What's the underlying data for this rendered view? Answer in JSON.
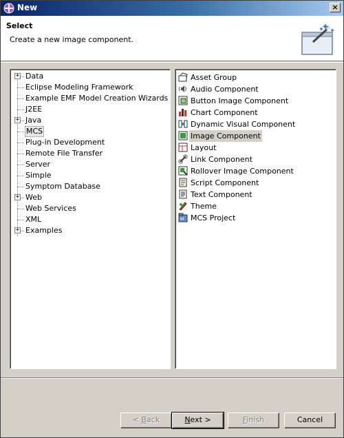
{
  "window": {
    "title": "New",
    "close_symbol": "×"
  },
  "header": {
    "title": "Select",
    "description": "Create a new image component."
  },
  "tree": {
    "items": [
      {
        "label": "Data",
        "expandable": true
      },
      {
        "label": "Eclipse Modeling Framework",
        "expandable": false
      },
      {
        "label": "Example EMF Model Creation Wizards",
        "expandable": false
      },
      {
        "label": "J2EE",
        "expandable": false
      },
      {
        "label": "Java",
        "expandable": true
      },
      {
        "label": "MCS",
        "expandable": false,
        "selected": true
      },
      {
        "label": "Plug-in Development",
        "expandable": false
      },
      {
        "label": "Remote File Transfer",
        "expandable": false
      },
      {
        "label": "Server",
        "expandable": false
      },
      {
        "label": "Simple",
        "expandable": false
      },
      {
        "label": "Symptom Database",
        "expandable": false
      },
      {
        "label": "Web",
        "expandable": true
      },
      {
        "label": "Web Services",
        "expandable": false
      },
      {
        "label": "XML",
        "expandable": false
      },
      {
        "label": "Examples",
        "expandable": true
      }
    ],
    "expander_symbol": "+"
  },
  "wizards": {
    "items": [
      {
        "label": "Asset Group",
        "icon": "asset-group-icon"
      },
      {
        "label": "Audio Component",
        "icon": "audio-icon"
      },
      {
        "label": "Button Image Component",
        "icon": "button-image-icon"
      },
      {
        "label": "Chart Component",
        "icon": "chart-icon"
      },
      {
        "label": "Dynamic Visual Component",
        "icon": "dynamic-visual-icon"
      },
      {
        "label": "Image Component",
        "icon": "image-icon",
        "selected": true
      },
      {
        "label": "Layout",
        "icon": "layout-icon"
      },
      {
        "label": "Link Component",
        "icon": "link-icon"
      },
      {
        "label": "Rollover Image Component",
        "icon": "rollover-image-icon"
      },
      {
        "label": "Script Component",
        "icon": "script-icon"
      },
      {
        "label": "Text Component",
        "icon": "text-icon"
      },
      {
        "label": "Theme",
        "icon": "theme-icon"
      },
      {
        "label": "MCS Project",
        "icon": "mcs-project-icon"
      }
    ]
  },
  "buttons": {
    "back": {
      "prefix": "< ",
      "mnemonic": "B",
      "rest": "ack",
      "enabled": false
    },
    "next": {
      "mnemonic": "N",
      "rest": "ext >",
      "enabled": true
    },
    "finish": {
      "mnemonic": "F",
      "rest": "inish",
      "enabled": false
    },
    "cancel": {
      "label": "Cancel",
      "enabled": true
    }
  },
  "colors": {
    "title_bar_start": "#0a246a",
    "title_bar_end": "#a6caf0",
    "dialog_background": "#d4d0c8",
    "selection_background": "#d4d0c8"
  }
}
